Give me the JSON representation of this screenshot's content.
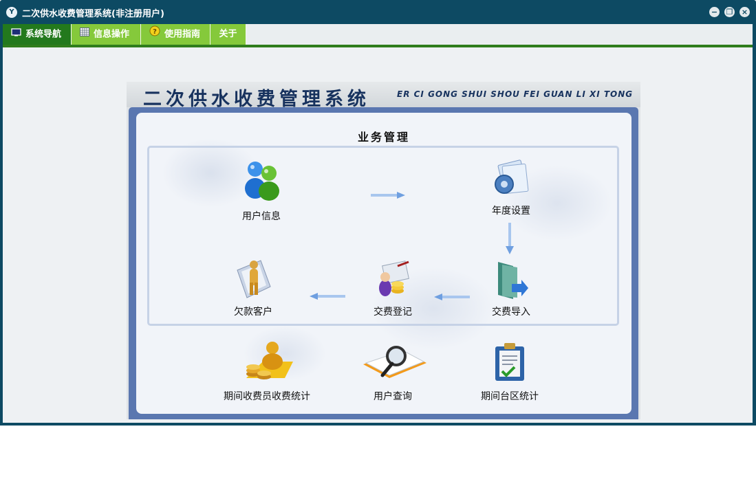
{
  "window": {
    "title": "二次供水收费管理系统(非注册用户)",
    "icon": "app-logo-icon",
    "controls": [
      "minimize-icon",
      "restore-icon",
      "close-icon"
    ]
  },
  "menu": {
    "tabs": [
      {
        "label": "系统导航",
        "icon": "monitor-icon",
        "active": true
      },
      {
        "label": "信息操作",
        "icon": "grid-icon",
        "active": false
      },
      {
        "label": "使用指南",
        "icon": "help-icon",
        "active": false
      },
      {
        "label": "关于",
        "icon": "",
        "active": false
      }
    ]
  },
  "banner": {
    "title_cn": "二次供水收费管理系统",
    "title_en": "ER CI GONG SHUI SHOU FEI GUAN LI XI TONG"
  },
  "business": {
    "title": "业务管理",
    "flow": [
      {
        "label": "用户信息",
        "icon": "users-icon"
      },
      {
        "label": "年度设置",
        "icon": "settings-folder-icon"
      },
      {
        "label": "交费导入",
        "icon": "import-folder-icon"
      },
      {
        "label": "交费登记",
        "icon": "fee-register-icon"
      },
      {
        "label": "欠款客户",
        "icon": "debtor-icon"
      }
    ],
    "tools": [
      {
        "label": "期间收费员收费统计",
        "icon": "collector-stats-icon"
      },
      {
        "label": "用户查询",
        "icon": "search-icon"
      },
      {
        "label": "期间台区统计",
        "icon": "clipboard-stats-icon"
      }
    ]
  },
  "colors": {
    "title_bar": "#0d4a63",
    "menu_active": "#23791d",
    "menu_tab": "#85c93b",
    "accent_line": "#2f7d1c",
    "panel_frame": "#5a77b0",
    "banner_text": "#17325e"
  }
}
